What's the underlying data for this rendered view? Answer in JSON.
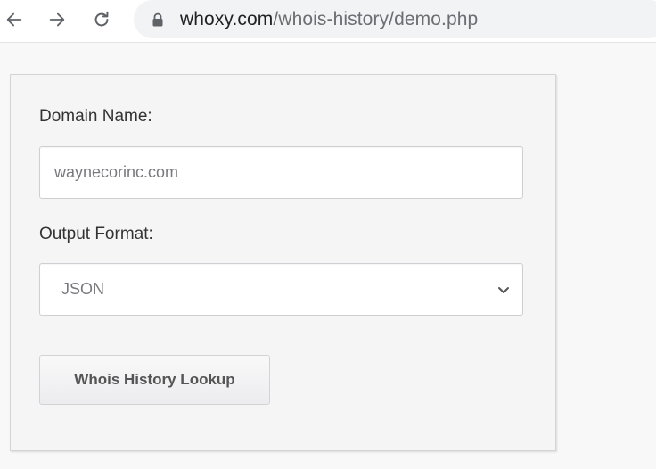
{
  "browser": {
    "url_host": "whoxy.com",
    "url_path": "/whois-history/demo.php"
  },
  "form": {
    "domain_label": "Domain Name:",
    "domain_value": "waynecorinc.com",
    "format_label": "Output Format:",
    "format_selected": "JSON",
    "submit_label": "Whois History Lookup"
  },
  "icons": {
    "back": "back-arrow-icon",
    "forward": "forward-arrow-icon",
    "reload": "reload-icon",
    "lock": "lock-icon",
    "dropdown": "chevron-down-icon"
  }
}
